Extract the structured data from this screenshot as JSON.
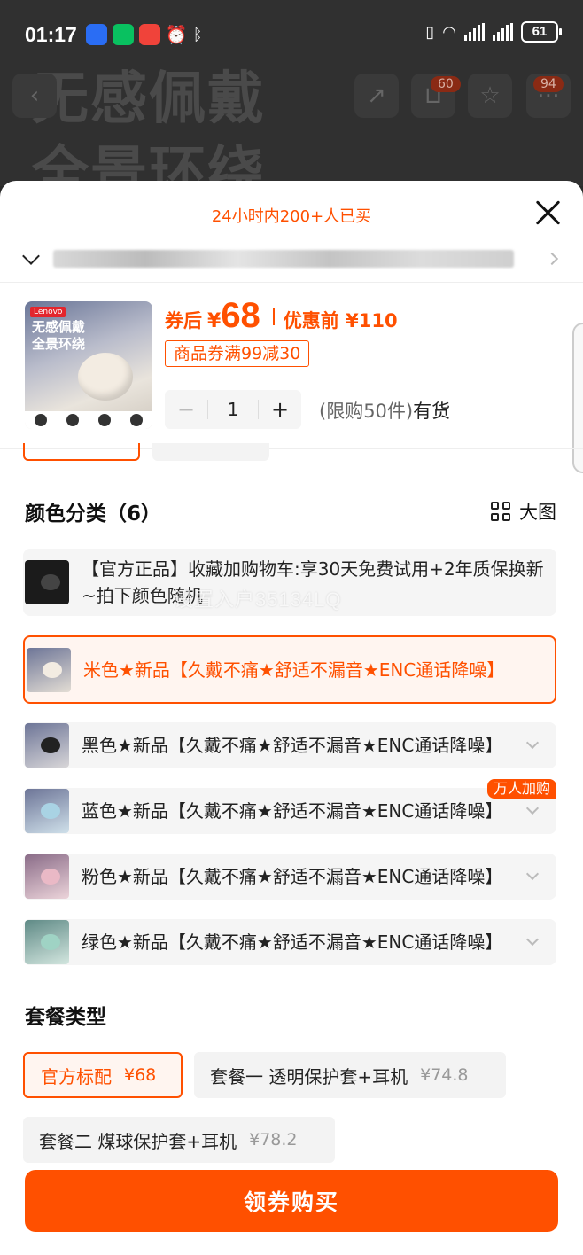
{
  "status_bar": {
    "time": "01:17",
    "battery": "61"
  },
  "background": {
    "title_line1": "无感佩戴",
    "title_line2": "全景环绕",
    "cart_badge": "60",
    "fav_badge": "94"
  },
  "sheet": {
    "sales_hint": "24小时内200+人已买",
    "product": {
      "thumb_brand": "Lenovo",
      "thumb_title_1": "无感佩戴",
      "thumb_title_2": "全景环绕",
      "price_prefix": "券后",
      "currency": "¥",
      "price": "68",
      "original_price": "优惠前 ¥110",
      "coupon": "商品券满99减30",
      "quantity": "1",
      "limit_text": "(限购50件)",
      "stock_text": "有货"
    },
    "color_section": {
      "title": "颜色分类（6）",
      "big_view_label": "大图",
      "watermark": "设置入户35134LQ",
      "options": [
        {
          "label": "【官方正品】收藏加购物车:享30天免费试用+2年质保换新~拍下颜色随机"
        },
        {
          "label": "米色★新品【久戴不痛★舒适不漏音★ENC通话降噪】"
        },
        {
          "label": "黑色★新品【久戴不痛★舒适不漏音★ENC通话降噪】"
        },
        {
          "label": "蓝色★新品【久戴不痛★舒适不漏音★ENC通话降噪】",
          "tag": "万人加购"
        },
        {
          "label": "粉色★新品【久戴不痛★舒适不漏音★ENC通话降噪】"
        },
        {
          "label": "绿色★新品【久戴不痛★舒适不漏音★ENC通话降噪】"
        }
      ]
    },
    "package_section": {
      "title": "套餐类型",
      "options": [
        {
          "label": "官方标配",
          "price": "¥68"
        },
        {
          "label": "套餐一 透明保护套+耳机",
          "price": "¥74.8"
        },
        {
          "label": "套餐二 煤球保护套+耳机",
          "price": "¥78.2"
        }
      ]
    },
    "buy_button": "领券购买"
  },
  "colors": {
    "accent": "#ff5000"
  }
}
